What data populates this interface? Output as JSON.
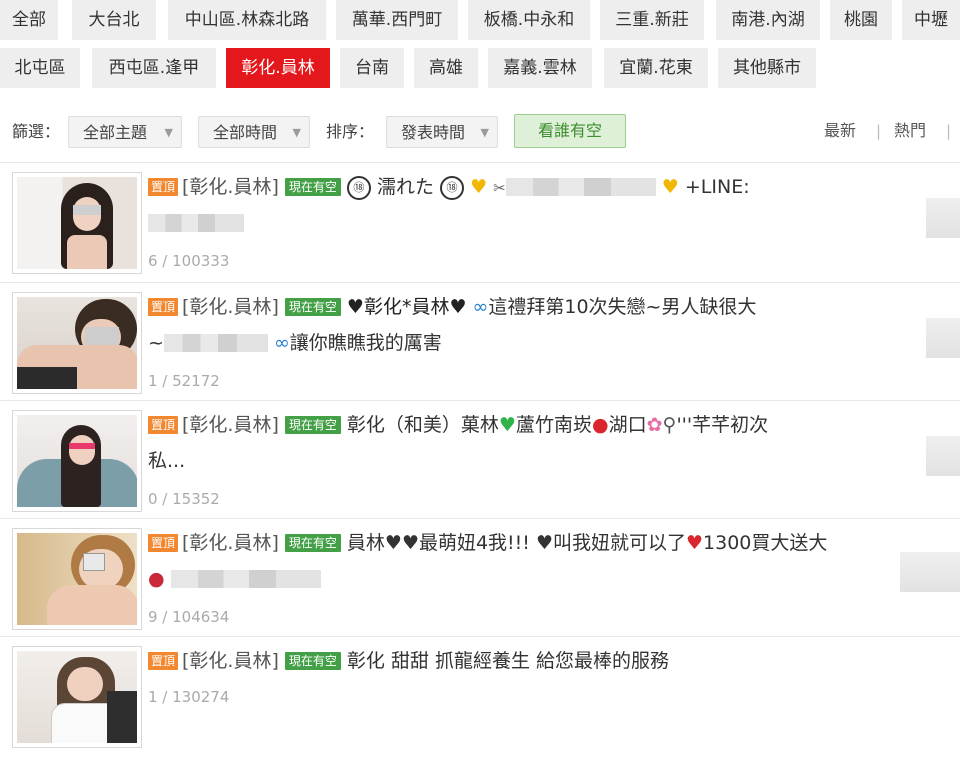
{
  "regions_row1": [
    {
      "label": "全部",
      "active": false
    },
    {
      "label": "大台北",
      "active": false
    },
    {
      "label": "中山區.林森北路",
      "active": false
    },
    {
      "label": "萬華.西門町",
      "active": false
    },
    {
      "label": "板橋.中永和",
      "active": false
    },
    {
      "label": "三重.新莊",
      "active": false
    },
    {
      "label": "南港.內湖",
      "active": false
    },
    {
      "label": "桃園",
      "active": false
    },
    {
      "label": "中壢",
      "active": false
    }
  ],
  "regions_row2": [
    {
      "label": "北屯區",
      "active": false
    },
    {
      "label": "西屯區.逢甲",
      "active": false
    },
    {
      "label": "彰化.員林",
      "active": true
    },
    {
      "label": "台南",
      "active": false
    },
    {
      "label": "高雄",
      "active": false
    },
    {
      "label": "嘉義.雲林",
      "active": false
    },
    {
      "label": "宜蘭.花東",
      "active": false
    },
    {
      "label": "其他縣市",
      "active": false
    }
  ],
  "filter": {
    "filter_label": "篩選：",
    "topic_select": "全部主題",
    "time_select": "全部時間",
    "sort_label": "排序：",
    "sort_select": "發表時間",
    "available_button": "看誰有空",
    "latest": "最新",
    "hot": "熱門",
    "separator": "|"
  },
  "colors": {
    "accent": "#e4181c",
    "pin_badge": "#f1872e",
    "now_badge": "#43a047"
  },
  "listings": [
    {
      "pin": "置頂",
      "region": "[彰化.員林]",
      "status": "現在有空",
      "title_parts": [
        "⑱",
        "濡れた",
        "⑱",
        "♥",
        "✂",
        "",
        "♥",
        "+LINE:"
      ],
      "stats": "6 / 100333"
    },
    {
      "pin": "置頂",
      "region": "[彰化.員林]",
      "status": "現在有空",
      "title_parts": [
        "♥彰化*員林♥",
        "這禮拜第10次失戀~男人缺很大",
        "~",
        "讓你瞧瞧我的厲害"
      ],
      "stats": "1 / 52172"
    },
    {
      "pin": "置頂",
      "region": "[彰化.員林]",
      "status": "現在有空",
      "title_parts": [
        "彰化（和美）菓林",
        "蘆竹南崁",
        "湖口",
        "'''芊芊初次",
        "私..."
      ],
      "stats": "0 / 15352"
    },
    {
      "pin": "置頂",
      "region": "[彰化.員林]",
      "status": "現在有空",
      "title_parts": [
        "員林♥♥最萌妞4我!!! ♥叫我妞就可以了",
        "1300買大送大"
      ],
      "stats": "9 / 104634"
    },
    {
      "pin": "置頂",
      "region": "[彰化.員林]",
      "status": "現在有空",
      "title_parts": [
        "彰化 甜甜 抓龍經養生 給您最棒的服務"
      ],
      "stats": "1 / 130274"
    }
  ]
}
